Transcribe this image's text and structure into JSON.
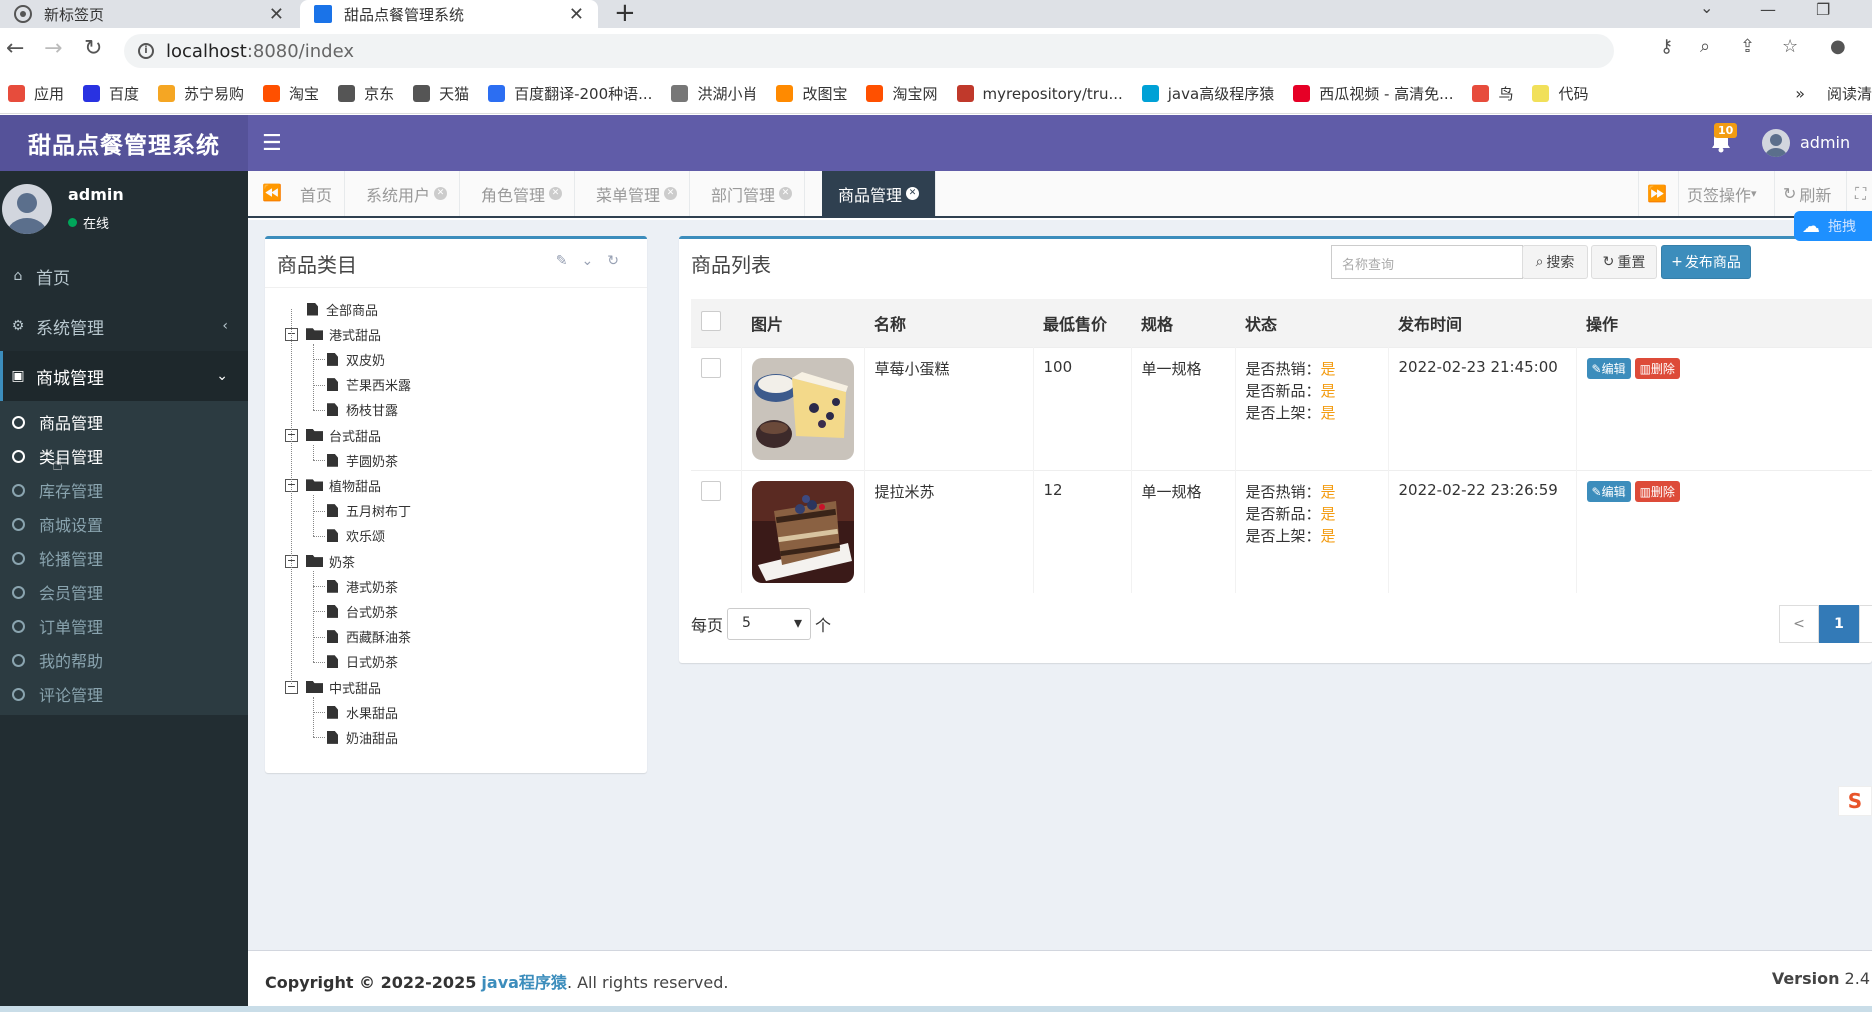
{
  "browser": {
    "tabs": [
      {
        "title": "新标签页",
        "active": false
      },
      {
        "title": "甜品点餐管理系统",
        "active": true
      }
    ],
    "url_host": "localhost",
    "url_rest": ":8080/index",
    "bookmarks": [
      {
        "label": "应用",
        "color": "#e74c3c",
        "icon": "apps-grid-icon"
      },
      {
        "label": "百度",
        "color": "#2932e1",
        "icon": "baidu-icon"
      },
      {
        "label": "苏宁易购",
        "color": "#f5a623",
        "icon": "suning-icon"
      },
      {
        "label": "淘宝",
        "color": "#ff5000",
        "icon": "taobao-icon"
      },
      {
        "label": "京东",
        "color": "#555555",
        "icon": "globe-icon"
      },
      {
        "label": "天猫",
        "color": "#555555",
        "icon": "globe-icon"
      },
      {
        "label": "百度翻译-200种语...",
        "color": "#2c6ef2",
        "icon": "translate-icon"
      },
      {
        "label": "洪湖小肖",
        "color": "#777777",
        "icon": "bird-icon"
      },
      {
        "label": "改图宝",
        "color": "#ff8a00",
        "icon": "image-icon"
      },
      {
        "label": "淘宝网",
        "color": "#ff5000",
        "icon": "taobao-icon"
      },
      {
        "label": "myrepository/tru...",
        "color": "#c0392b",
        "icon": "chrome-icon"
      },
      {
        "label": "java高级程序猿",
        "color": "#00a1d6",
        "icon": "bilibili-icon"
      },
      {
        "label": "西瓜视频 - 高清免...",
        "color": "#e60026",
        "icon": "play-icon"
      },
      {
        "label": "鸟",
        "color": "#e74c3c",
        "icon": "bird-icon"
      },
      {
        "label": "代码",
        "color": "#f1e05a",
        "icon": "code-icon"
      }
    ],
    "more": "»",
    "reading_list": "阅读清"
  },
  "header": {
    "logo": "甜品点餐管理系统",
    "notif_count": "10",
    "user": "admin"
  },
  "sidebar": {
    "user_name": "admin",
    "user_status": "在线",
    "menu": [
      {
        "label": "首页",
        "icon": "home-icon"
      },
      {
        "label": "系统管理",
        "icon": "cogs-icon",
        "chevron": "‹"
      },
      {
        "label": "商城管理",
        "icon": "shopping-bag-icon",
        "chevron": "⌄",
        "open": true
      }
    ],
    "submenu": [
      {
        "label": "商品管理",
        "active": true
      },
      {
        "label": "类目管理",
        "active": true
      },
      {
        "label": "库存管理"
      },
      {
        "label": "商城设置"
      },
      {
        "label": "轮播管理"
      },
      {
        "label": "会员管理"
      },
      {
        "label": "订单管理"
      },
      {
        "label": "我的帮助"
      },
      {
        "label": "评论管理"
      }
    ]
  },
  "content_tabs": [
    {
      "label": "首页",
      "closable": false
    },
    {
      "label": "系统用户",
      "closable": true
    },
    {
      "label": "角色管理",
      "closable": true
    },
    {
      "label": "菜单管理",
      "closable": true
    },
    {
      "label": "部门管理",
      "closable": true
    },
    {
      "label": "商品管理",
      "closable": true,
      "active": true
    }
  ],
  "tab_tools": {
    "ops": "页签操作",
    "refresh": "刷新"
  },
  "category_panel": {
    "title": "商品类目",
    "tree": [
      {
        "label": "全部商品",
        "level": 0,
        "type": "file"
      },
      {
        "label": "港式甜品",
        "level": 0,
        "type": "folder"
      },
      {
        "label": "双皮奶",
        "level": 1,
        "type": "file"
      },
      {
        "label": "芒果西米露",
        "level": 1,
        "type": "file"
      },
      {
        "label": "杨枝甘露",
        "level": 1,
        "type": "file"
      },
      {
        "label": "台式甜品",
        "level": 0,
        "type": "folder"
      },
      {
        "label": "芋圆奶茶",
        "level": 1,
        "type": "file"
      },
      {
        "label": "植物甜品",
        "level": 0,
        "type": "folder"
      },
      {
        "label": "五月树布丁",
        "level": 1,
        "type": "file"
      },
      {
        "label": "欢乐颂",
        "level": 1,
        "type": "file"
      },
      {
        "label": "奶茶",
        "level": 0,
        "type": "folder"
      },
      {
        "label": "港式奶茶",
        "level": 1,
        "type": "file"
      },
      {
        "label": "台式奶茶",
        "level": 1,
        "type": "file"
      },
      {
        "label": "西藏酥油茶",
        "level": 1,
        "type": "file"
      },
      {
        "label": "日式奶茶",
        "level": 1,
        "type": "file"
      },
      {
        "label": "中式甜品",
        "level": 0,
        "type": "folder"
      },
      {
        "label": "水果甜品",
        "level": 1,
        "type": "file"
      },
      {
        "label": "奶油甜品",
        "level": 1,
        "type": "file"
      }
    ]
  },
  "product_panel": {
    "title": "商品列表",
    "search_placeholder": "名称查询",
    "search_btn": "搜索",
    "reset_btn": "重置",
    "publish_btn": "发布商品",
    "columns": [
      "图片",
      "名称",
      "最低售价",
      "规格",
      "状态",
      "发布时间",
      "操作"
    ],
    "rows": [
      {
        "image": "cake-slice-with-berries",
        "name": "草莓小蛋糕",
        "price": "100",
        "spec": "单一规格",
        "status": [
          {
            "k": "是否热销：",
            "v": "是"
          },
          {
            "k": "是否新品：",
            "v": "是"
          },
          {
            "k": "是否上架：",
            "v": "是"
          }
        ],
        "time": "2022-02-23 21:45:00"
      },
      {
        "image": "tiramisu-slice-with-blueberries",
        "name": "提拉米苏",
        "price": "12",
        "spec": "单一规格",
        "status": [
          {
            "k": "是否热销：",
            "v": "是"
          },
          {
            "k": "是否新品：",
            "v": "是"
          },
          {
            "k": "是否上架：",
            "v": "是"
          }
        ],
        "time": "2022-02-22 23:26:59"
      }
    ],
    "edit_label": "编辑",
    "delete_label": "删除",
    "per_page_prefix": "每页",
    "per_page_value": "5",
    "per_page_suffix": "个",
    "pager": {
      "prev": "<",
      "current": "1",
      "next": ">"
    }
  },
  "floaters": {
    "cloud_label": "拖拽",
    "s_label": "S"
  },
  "footer": {
    "copyright_prefix": "Copyright © 2022-2025",
    "copyright_link": "java程序猿",
    "copyright_suffix": ". All rights reserved.",
    "version_label": "Version",
    "version_value": "2.4"
  }
}
